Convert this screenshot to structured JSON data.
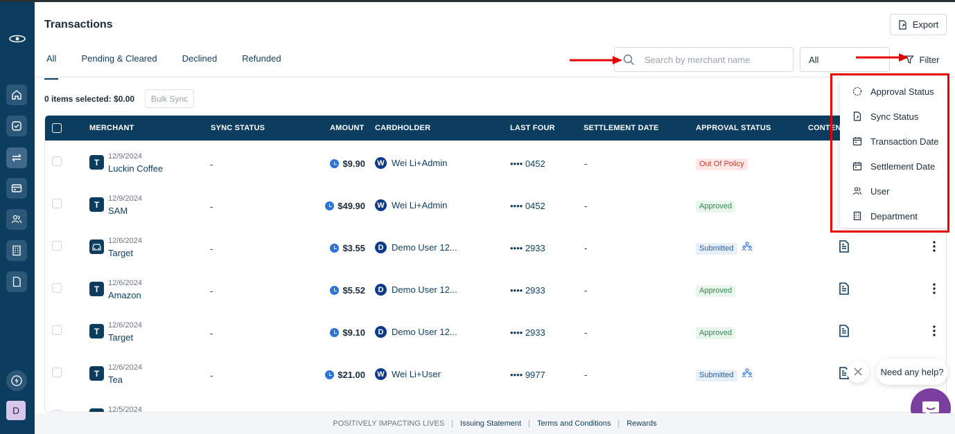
{
  "page": {
    "title": "Transactions",
    "export_label": "Export"
  },
  "tabs": [
    {
      "label": "All",
      "active": true
    },
    {
      "label": "Pending & Cleared",
      "active": false
    },
    {
      "label": "Declined",
      "active": false
    },
    {
      "label": "Refunded",
      "active": false
    }
  ],
  "search": {
    "placeholder": "Search by merchant name",
    "value": ""
  },
  "type_select": {
    "value": "All"
  },
  "filter": {
    "label": "Filter"
  },
  "selection": {
    "summary": "0 items selected: $0.00",
    "bulk_label": "Bulk Sync"
  },
  "table": {
    "columns": [
      "MERCHANT",
      "SYNC STATUS",
      "AMOUNT",
      "CARDHOLDER",
      "LAST FOUR",
      "SETTLEMENT DATE",
      "APPROVAL STATUS",
      "CONTENT"
    ],
    "rows": [
      {
        "icon": "T",
        "date": "12/9/2024",
        "merchant": "Luckin Coffee",
        "sync": "-",
        "amount": "$9.90",
        "ch_initial": "W",
        "cardholder": "Wei Li+Admin",
        "last_four": "•••• 0452",
        "settlement": "-",
        "approval": "Out Of Policy",
        "approval_kind": "oop"
      },
      {
        "icon": "T",
        "date": "12/9/2024",
        "merchant": "SAM",
        "sync": "-",
        "amount": "$49.90",
        "ch_initial": "W",
        "cardholder": "Wei Li+Admin",
        "last_four": "•••• 0452",
        "settlement": "-",
        "approval": "Approved",
        "approval_kind": "app"
      },
      {
        "icon": "car",
        "date": "12/6/2024",
        "merchant": "Target",
        "sync": "-",
        "amount": "$3.55",
        "ch_initial": "D",
        "cardholder": "Demo User 12...",
        "last_four": "•••• 2933",
        "settlement": "-",
        "approval": "Submitted",
        "approval_kind": "sub"
      },
      {
        "icon": "T",
        "date": "12/6/2024",
        "merchant": "Amazon",
        "sync": "-",
        "amount": "$5.52",
        "ch_initial": "D",
        "cardholder": "Demo User 12...",
        "last_four": "•••• 2933",
        "settlement": "-",
        "approval": "Approved",
        "approval_kind": "app"
      },
      {
        "icon": "T",
        "date": "12/6/2024",
        "merchant": "Target",
        "sync": "-",
        "amount": "$9.10",
        "ch_initial": "D",
        "cardholder": "Demo User 12...",
        "last_four": "•••• 2933",
        "settlement": "-",
        "approval": "Approved",
        "approval_kind": "app"
      },
      {
        "icon": "T",
        "date": "12/6/2024",
        "merchant": "Tea",
        "sync": "-",
        "amount": "$21.00",
        "ch_initial": "W",
        "cardholder": "Wei Li+User",
        "last_four": "•••• 9977",
        "settlement": "-",
        "approval": "Submitted",
        "approval_kind": "sub"
      },
      {
        "icon": "T",
        "date": "12/5/2024",
        "merchant": "",
        "sync": "",
        "amount": "",
        "ch_initial": "",
        "cardholder": "",
        "last_four": "",
        "settlement": "",
        "approval": "",
        "approval_kind": ""
      }
    ]
  },
  "filter_menu": {
    "items": [
      {
        "label": "Approval Status",
        "icon": "dashed-circle-icon"
      },
      {
        "label": "Sync Status",
        "icon": "file-sync-icon"
      },
      {
        "label": "Transaction Date",
        "icon": "calendar-icon"
      },
      {
        "label": "Settlement Date",
        "icon": "calendar-icon"
      },
      {
        "label": "User",
        "icon": "users-icon"
      },
      {
        "label": "Department",
        "icon": "building-icon"
      }
    ]
  },
  "help": {
    "bubble": "Need any help?"
  },
  "user": {
    "initial": "D"
  },
  "footer": {
    "tagline": "POSITIVELY IMPACTING LIVES",
    "links": [
      "Issuing Statement",
      "Terms and Conditions",
      "Rewards"
    ]
  },
  "colors": {
    "primary": "#0c3d5f",
    "annotation": "#e60000",
    "chat": "#7b3fa0"
  }
}
